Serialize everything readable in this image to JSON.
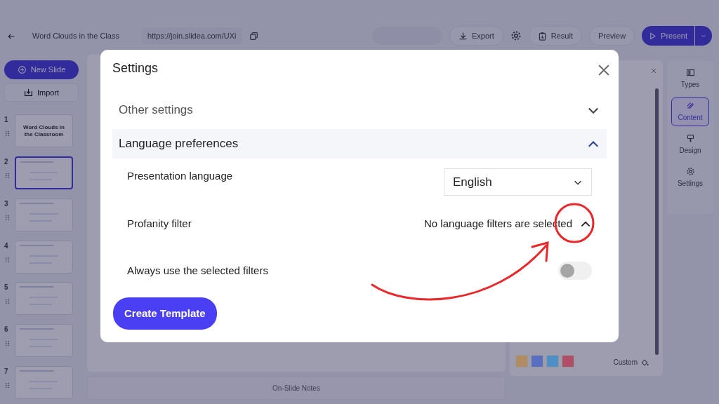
{
  "topbar": {
    "title": "Word Clouds in the Class",
    "url": "https://join.slidea.com/UXi",
    "actions": [
      {
        "kind": "disabled"
      },
      {
        "kind": "button",
        "label": "Export"
      },
      {
        "kind": "icon"
      },
      {
        "kind": "button",
        "label": "Result"
      },
      {
        "kind": "button",
        "label": "Preview"
      },
      {
        "kind": "primary",
        "label": "Present"
      }
    ]
  },
  "sidebar": {
    "new_slide": "New Slide",
    "import": "Import",
    "slides": [
      {
        "number": "1",
        "selected": false,
        "title": "Word Clouds in the Classroom"
      },
      {
        "number": "2",
        "selected": true
      },
      {
        "number": "3",
        "selected": false
      },
      {
        "number": "4",
        "selected": false
      },
      {
        "number": "5",
        "selected": false
      },
      {
        "number": "6",
        "selected": false
      },
      {
        "number": "7",
        "selected": false
      }
    ]
  },
  "notes": "On-Slide Notes",
  "side_tabs": [
    {
      "label": "Types",
      "selected": false
    },
    {
      "label": "Content",
      "selected": true
    },
    {
      "label": "Design",
      "selected": false
    },
    {
      "label": "Settings",
      "selected": false
    }
  ],
  "panel": {
    "swatches": [
      {
        "color": "#b08b63"
      },
      {
        "color": "#5a6fc0"
      },
      {
        "color": "#4f8fc8"
      },
      {
        "color": "#b04e68"
      }
    ],
    "custom": "Custom"
  },
  "modal": {
    "title": "Settings",
    "sections": [
      {
        "title": "Other settings",
        "expanded": false
      },
      {
        "title": "Language preferences",
        "expanded": true,
        "rows": [
          {
            "kind": "select",
            "label": "Presentation language",
            "value": "English"
          },
          {
            "kind": "dropdown",
            "label": "Profanity filter",
            "value": "No language filters are selected",
            "expanded": true
          },
          {
            "kind": "toggle",
            "label": "Always use the selected filters",
            "on": false
          }
        ]
      }
    ],
    "button": "Create Template"
  }
}
